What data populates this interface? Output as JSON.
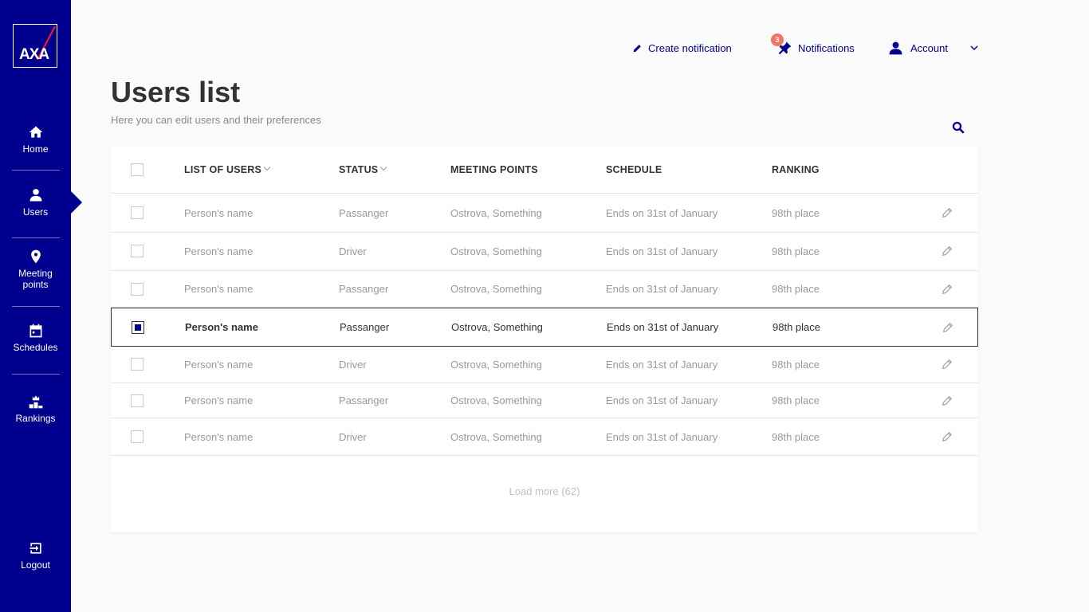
{
  "brand": {
    "logo_text": "AXA",
    "primary": "#00008f",
    "accent": "#f07662"
  },
  "sidebar": {
    "items": [
      {
        "label": "Home",
        "icon": "home-icon"
      },
      {
        "label": "Users",
        "icon": "user-icon",
        "active": true
      },
      {
        "label": "Meeting points",
        "icon": "location-pin-icon"
      },
      {
        "label": "Schedules",
        "icon": "calendar-icon"
      },
      {
        "label": "Rankings",
        "icon": "podium-icon"
      }
    ],
    "logout": {
      "label": "Logout",
      "icon": "logout-icon"
    }
  },
  "header": {
    "create_notification": "Create notification",
    "notifications": "Notifications",
    "notifications_count": "3",
    "account": "Account"
  },
  "page": {
    "title": "Users list",
    "subtitle": "Here you can edit users and their preferences"
  },
  "table": {
    "columns": [
      "LIST OF USERS",
      "STATUS",
      "MEETING POINTS",
      "SCHEDULE",
      "RANKING"
    ],
    "rows": [
      {
        "name": "Person's name",
        "status": "Passanger",
        "meeting": "Ostrova, Something",
        "schedule": "Ends on 31st of January",
        "ranking": "98th place",
        "checked": false
      },
      {
        "name": "Person's name",
        "status": "Driver",
        "meeting": "Ostrova, Something",
        "schedule": "Ends on 31st of January",
        "ranking": "98th place",
        "checked": false
      },
      {
        "name": "Person's name",
        "status": "Passanger",
        "meeting": "Ostrova, Something",
        "schedule": "Ends on 31st of January",
        "ranking": "98th place",
        "checked": false
      },
      {
        "name": "Person's name",
        "status": "Passanger",
        "meeting": "Ostrova, Something",
        "schedule": "Ends on 31st of January",
        "ranking": "98th place",
        "checked": true
      },
      {
        "name": "Person's name",
        "status": "Driver",
        "meeting": "Ostrova, Something",
        "schedule": "Ends on 31st of January",
        "ranking": "98th place",
        "checked": false
      },
      {
        "name": "Person's name",
        "status": "Passanger",
        "meeting": "Ostrova, Something",
        "schedule": "Ends on 31st of January",
        "ranking": "98th place",
        "checked": false
      },
      {
        "name": "Person's name",
        "status": "Driver",
        "meeting": "Ostrova, Something",
        "schedule": "Ends on 31st of January",
        "ranking": "98th place",
        "checked": false
      }
    ],
    "load_more": "Load more (62)"
  }
}
